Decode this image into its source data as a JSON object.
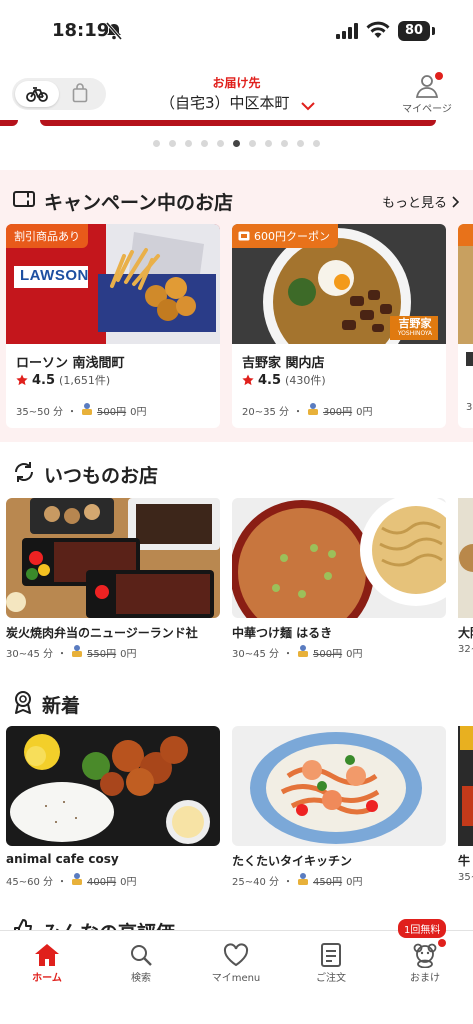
{
  "status": {
    "time": "18:19",
    "battery": "80"
  },
  "header": {
    "deliver_label": "お届け先",
    "address": "（自宅3）中区本町",
    "mypage_label": "マイページ"
  },
  "carousel": {
    "count": 11,
    "active_index": 5
  },
  "campaign": {
    "title": "キャンペーン中のお店",
    "more": "もっと見る",
    "cards": [
      {
        "badge": "割引商品あり",
        "brand": "LAWSON",
        "name": "ローソン 南浅間町",
        "rating": "4.5",
        "count": "(1,651件)",
        "time": "35~50 分",
        "old_fee": "500円",
        "fee": "0円"
      },
      {
        "badge": "600円クーポン",
        "brand": "吉野家",
        "brand_sub": "YOSHINOYA",
        "name": "吉野家 関内店",
        "rating": "4.5",
        "count": "(430件)",
        "time": "20~35 分",
        "old_fee": "300円",
        "fee": "0円"
      }
    ]
  },
  "usual": {
    "title": "いつものお店",
    "cards": [
      {
        "name": "炭火焼肉弁当のニュージーランド社",
        "time": "30~45 分",
        "old_fee": "550円",
        "fee": "0円"
      },
      {
        "name": "中華つけ麺 はるき",
        "time": "30~45 分",
        "old_fee": "500円",
        "fee": "0円"
      },
      {
        "name": "大阪",
        "time": "32~"
      }
    ]
  },
  "new": {
    "title": "新着",
    "cards": [
      {
        "name": "animal cafe cosy",
        "time": "45~60 分",
        "old_fee": "400円",
        "fee": "0円"
      },
      {
        "name": "たくたいタイキッチン",
        "time": "25~40 分",
        "old_fee": "450円",
        "fee": "0円"
      },
      {
        "name": "牛",
        "time": "35~"
      }
    ]
  },
  "popular": {
    "title": "みんなの高評価"
  },
  "bottom_nav": {
    "items": [
      {
        "label": "ホーム"
      },
      {
        "label": "検索"
      },
      {
        "label": "マイmenu"
      },
      {
        "label": "ご注文"
      },
      {
        "label": "おまけ"
      }
    ],
    "free_badge": "1回無料"
  },
  "colors": {
    "accent": "#e0201c",
    "campaign_bg": "#fdf1f1"
  }
}
